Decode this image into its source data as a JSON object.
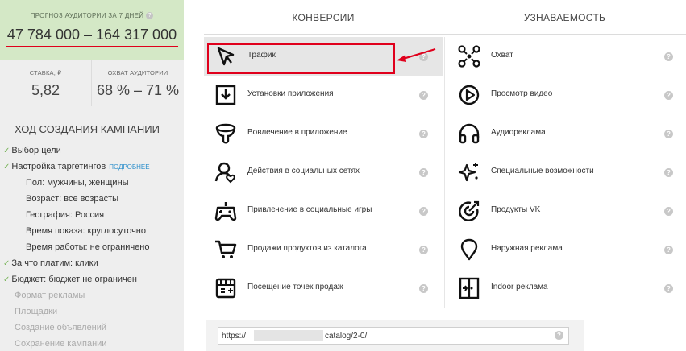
{
  "forecast": {
    "label": "ПРОГНОЗ АУДИТОРИИ ЗА 7 ДНЕЙ",
    "value": "47 784 000 – 164 317 000"
  },
  "stats": {
    "rate": {
      "label": "СТАВКА, ₽",
      "value": "5,82"
    },
    "coverage": {
      "label": "ОХВАТ АУДИТОРИИ",
      "value": "68 % – 71 %"
    }
  },
  "sidebar": {
    "title": "ХОД СОЗДАНИЯ КАМПАНИИ",
    "more": "ПОДРОБНЕЕ",
    "steps": [
      {
        "label": "Выбор цели",
        "state": "done"
      },
      {
        "label": "Настройка таргетингов",
        "state": "done"
      },
      {
        "label": "Пол: мужчины, женщины",
        "state": "sub"
      },
      {
        "label": "Возраст: все возрасты",
        "state": "sub"
      },
      {
        "label": "География: Россия",
        "state": "sub"
      },
      {
        "label": "Время показа: круглосуточно",
        "state": "sub"
      },
      {
        "label": "Время работы: не ограничено",
        "state": "sub"
      },
      {
        "label": "За что платим: клики",
        "state": "done"
      },
      {
        "label": "Бюджет: бюджет не ограничен",
        "state": "done"
      },
      {
        "label": "Формат рекламы",
        "state": "todo"
      },
      {
        "label": "Площадки",
        "state": "todo"
      },
      {
        "label": "Создание объявлений",
        "state": "todo"
      },
      {
        "label": "Сохранение кампании",
        "state": "todo"
      }
    ]
  },
  "tabs": [
    {
      "label": "КОНВЕРСИИ"
    },
    {
      "label": "УЗНАВАЕМОСТЬ"
    }
  ],
  "conversions": [
    {
      "label": "Трафик",
      "icon": "cursor-icon"
    },
    {
      "label": "Установки приложения",
      "icon": "download-icon"
    },
    {
      "label": "Вовлечение в приложение",
      "icon": "funnel-icon"
    },
    {
      "label": "Действия в социальных сетях",
      "icon": "social-icon"
    },
    {
      "label": "Привлечение в социальные игры",
      "icon": "gamepad-icon"
    },
    {
      "label": "Продажи продуктов из каталога",
      "icon": "cart-icon"
    },
    {
      "label": "Посещение точек продаж",
      "icon": "store-icon"
    }
  ],
  "awareness": [
    {
      "label": "Охват",
      "icon": "reach-icon"
    },
    {
      "label": "Просмотр видео",
      "icon": "play-icon"
    },
    {
      "label": "Аудиореклама",
      "icon": "headphones-icon"
    },
    {
      "label": "Специальные возможности",
      "icon": "sparkles-icon"
    },
    {
      "label": "Продукты VK",
      "icon": "target-icon"
    },
    {
      "label": "Наружная реклама",
      "icon": "map-pin-icon"
    },
    {
      "label": "Indoor реклама",
      "icon": "door-icon"
    }
  ],
  "help_glyph": "?",
  "url": {
    "prefix": "https://",
    "suffix": "catalog/2-0/"
  },
  "colors": {
    "accent": "#e0001c",
    "forecast_bg": "#d4e8c6",
    "sidebar_bg": "#eeeeee",
    "check": "#7ab55c",
    "link": "#2a8ecb"
  }
}
